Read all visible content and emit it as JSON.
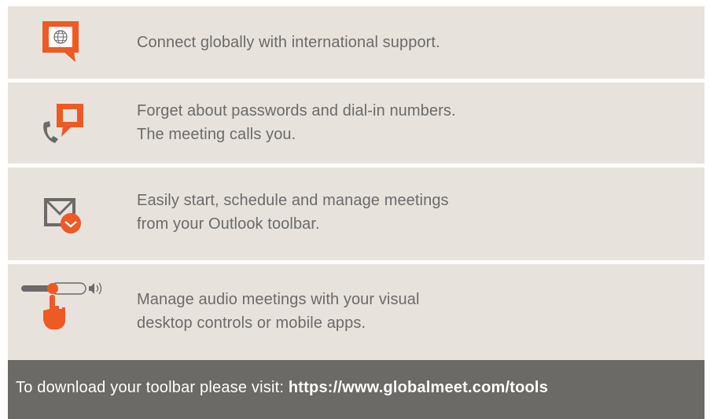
{
  "features": [
    {
      "icon": "globe-chat-icon",
      "lines": [
        "Connect globally with international support."
      ]
    },
    {
      "icon": "phone-chat-icon",
      "lines": [
        "Forget about passwords and dial-in numbers.",
        "The meeting calls you."
      ]
    },
    {
      "icon": "outlook-clock-icon",
      "lines": [
        "Easily start, schedule and manage meetings",
        "from your Outlook toolbar."
      ]
    },
    {
      "icon": "audio-slider-hand-icon",
      "lines": [
        "Manage audio meetings with your visual",
        "desktop controls or mobile apps."
      ]
    }
  ],
  "footer": {
    "prefix": "To download your toolbar please visit: ",
    "url": "https://www.globalmeet.com/tools"
  },
  "colors": {
    "accent": "#ee5a24",
    "row_bg": "#e7e2dc",
    "footer_bg": "#6b6a67",
    "text": "#6b6b6b",
    "icon_gray": "#6a6a6a"
  }
}
